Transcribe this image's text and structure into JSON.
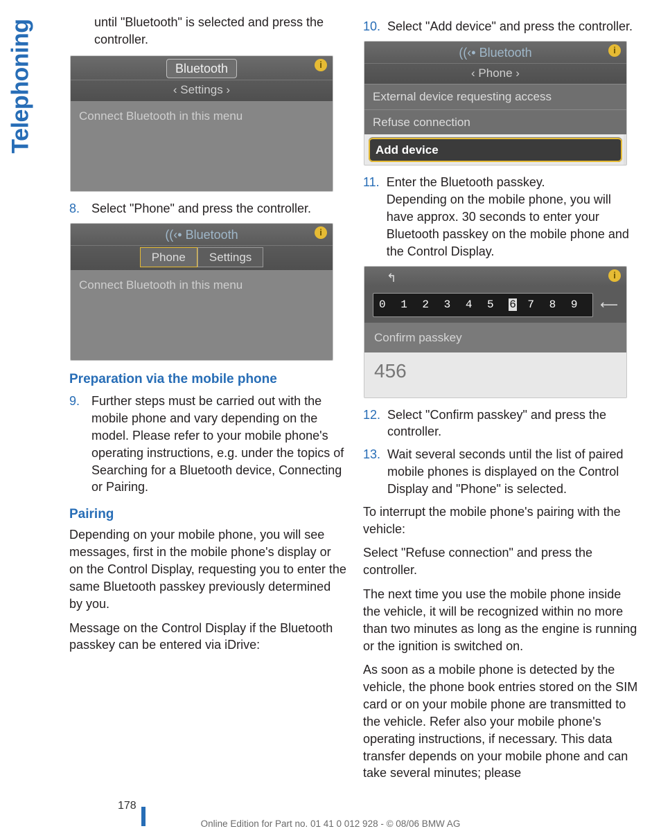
{
  "side_tab": "Telephoning",
  "left": {
    "intro": "until \"Bluetooth\" is selected and press the controller.",
    "shot1": {
      "pill": "Bluetooth",
      "sub": "‹ Settings ›",
      "body": "Connect Bluetooth in this menu"
    },
    "step8_num": "8.",
    "step8": "Select \"Phone\" and press the controller.",
    "shot2": {
      "title_prefix": "((‹• ",
      "title": "Bluetooth",
      "tab_active": "Phone",
      "tab_other": "Settings",
      "body": "Connect Bluetooth in this menu"
    },
    "prep_head": "Preparation via the mobile phone",
    "step9_num": "9.",
    "step9": "Further steps must be carried out with the mobile phone and vary depending on the model. Please refer to your mobile phone's operating instructions, e.g. under the topics of Searching for a Bluetooth device, Connecting or Pairing.",
    "pairing_head": "Pairing",
    "pairing_p1": "Depending on your mobile phone, you will see messages, first in the mobile phone's display or on the Control Display, requesting you to enter the same Bluetooth passkey previously determined by you.",
    "pairing_p2": "Message on the Control Display if the Bluetooth passkey can be entered via iDrive:"
  },
  "right": {
    "step10_num": "10.",
    "step10": "Select \"Add device\" and press the controller.",
    "shot3": {
      "title_prefix": "((‹• ",
      "title": "Bluetooth",
      "sub": "‹ Phone ›",
      "row1": "External device requesting access",
      "row2": "Refuse connection",
      "row3": "Add device"
    },
    "step11_num": "11.",
    "step11a": "Enter the Bluetooth passkey.",
    "step11b": "Depending on the mobile phone, you will have approx. 30 seconds to enter your Bluetooth passkey on the mobile phone and the Control Display.",
    "shot4": {
      "back_icon": "↰",
      "digits_pre": "0 1 2 3 4 5 ",
      "digit_hl": "6",
      "digits_post": " 7 8 9",
      "back_arrow": "⟵",
      "confirm": "Confirm passkey",
      "entered": "456"
    },
    "step12_num": "12.",
    "step12": "Select \"Confirm passkey\" and press the controller.",
    "step13_num": "13.",
    "step13": "Wait several seconds until the list of paired mobile phones is displayed on the Control Display and \"Phone\" is selected.",
    "interrupt1": "To interrupt the mobile phone's pairing with the vehicle:",
    "interrupt2": "Select \"Refuse connection\" and press the controller.",
    "next_time": "The next time you use the mobile phone inside the vehicle, it will be recognized within no more than two minutes as long as the engine is running or the ignition is switched on.",
    "as_soon": "As soon as a mobile phone is detected by the vehicle, the phone book entries stored on the SIM card or on your mobile phone are transmitted to the vehicle. Refer also your mobile phone's operating instructions, if necessary. This data transfer depends on your mobile phone and can take several minutes; please"
  },
  "footer": {
    "page": "178",
    "line": "Online Edition for Part no. 01 41 0 012 928 - © 08/06 BMW AG"
  }
}
